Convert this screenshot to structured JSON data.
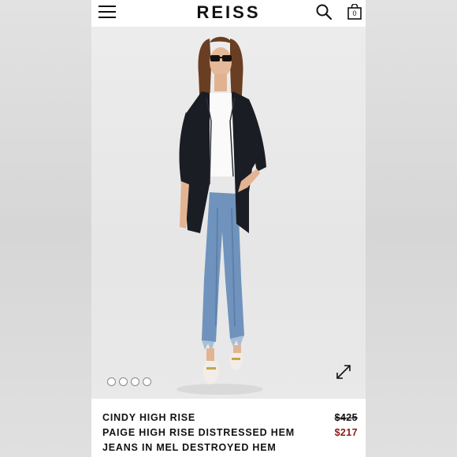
{
  "header": {
    "logo": "REISS",
    "bag_count": "0",
    "icons": {
      "menu": "hamburger-menu-icon",
      "search": "search-icon",
      "bag": "shopping-bag-icon"
    }
  },
  "gallery": {
    "dots_count": 4,
    "active_dot": 1,
    "expand_icon": "expand-diagonal-icon"
  },
  "product": {
    "name_lines": [
      "CINDY HIGH RISE",
      "PAIGE HIGH RISE DISTRESSED HEM",
      "JEANS IN MEL DESTROYED HEM"
    ],
    "price_original": "$425",
    "price_sale": "$217"
  },
  "colors": {
    "sale_price": "#8b1a1a",
    "background": "#ffffff",
    "blazer": "#1b1d24",
    "denim": "#6f93bd"
  }
}
